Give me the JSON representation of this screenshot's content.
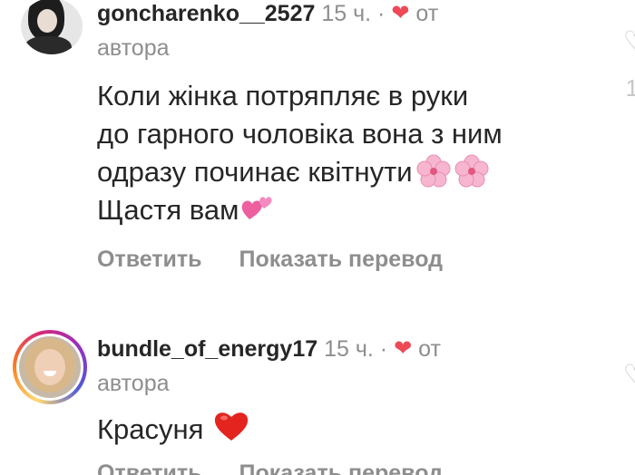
{
  "comments": [
    {
      "username": "goncharenko__2527",
      "time": "15 ч.",
      "dot": "·",
      "from_label_1": "от",
      "from_label_2": "автора",
      "text_lines": [
        "Коли жінка потряпляє в руки",
        "до гарного чоловіка вона з ним",
        "одразу починає квітнути",
        "Щастя вам"
      ],
      "reply": "Ответить",
      "translate": "Показать перевод",
      "edge_marks": [
        "1"
      ]
    },
    {
      "username": "bundle_of_energy17",
      "time": "15 ч.",
      "dot": "·",
      "from_label_1": "от",
      "from_label_2": "автора",
      "text": "Красуня",
      "reply": "Ответить",
      "translate": "Показать перевод"
    }
  ],
  "icons": {
    "liked_heart": "heart-icon",
    "flower": "cherry-blossom-icon",
    "two_hearts": "two-hearts-icon",
    "red_heart": "red-heart-icon"
  },
  "colors": {
    "text": "#262626",
    "muted": "#8e8e8e",
    "like": "#ed4956"
  }
}
